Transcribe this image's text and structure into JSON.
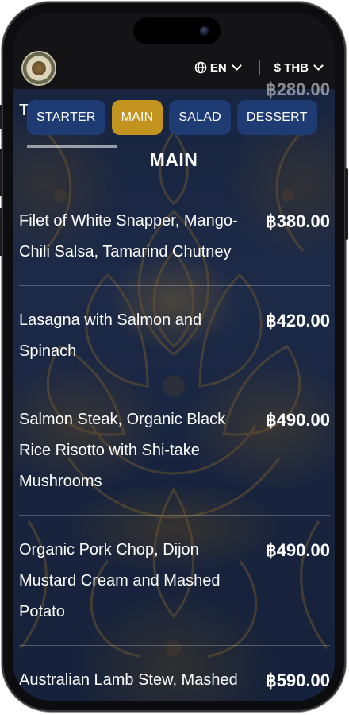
{
  "header": {
    "logo_alt": "restaurant logo",
    "language": "EN",
    "currency": "$ THB",
    "peek_price": "฿280.00",
    "peek_letter": "T"
  },
  "tabs": [
    {
      "label": "STARTER",
      "active": false
    },
    {
      "label": "MAIN",
      "active": true
    },
    {
      "label": "SALAD",
      "active": false
    },
    {
      "label": "DESSERT",
      "active": false
    }
  ],
  "section": {
    "title": "MAIN"
  },
  "menu_items": [
    {
      "name": "Filet of White Snapper, Mango-Chili Salsa, Tamarind Chutney",
      "price": "฿380.00"
    },
    {
      "name": "Lasagna with Salmon and Spinach",
      "price": "฿420.00"
    },
    {
      "name": "Salmon Steak, Organic Black Rice Risotto with Shi-take Mushrooms",
      "price": "฿490.00"
    },
    {
      "name": "Organic Pork Chop, Dijon Mustard Cream and Mashed Potato",
      "price": "฿490.00"
    },
    {
      "name": "Australian Lamb Stew, Mashed Potato",
      "price": "฿590.00"
    }
  ],
  "colors": {
    "tab_bg": "#1f3b73",
    "tab_active_bg": "#c39320",
    "topbar_bg": "#141416",
    "text": "#ffffff"
  }
}
